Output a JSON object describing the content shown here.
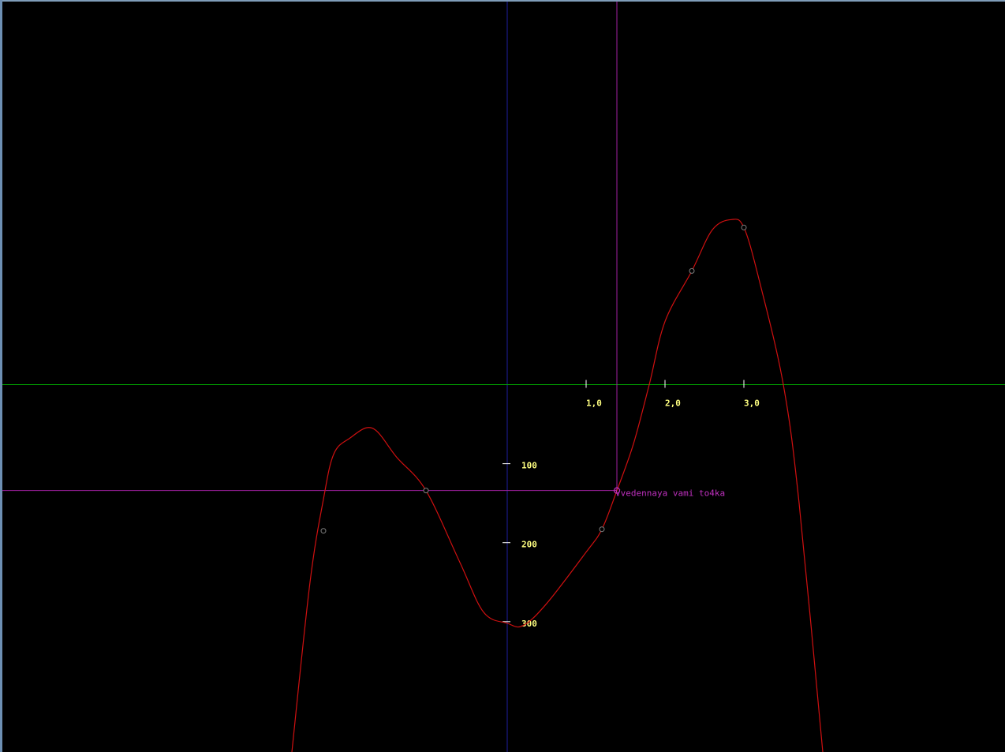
{
  "colors": {
    "background": "#000000",
    "x_axis": "#00b000",
    "y_axis": "#1e1ea0",
    "curve": "#d01010",
    "marker_line": "#a020a0",
    "tick_label": "#ffff80",
    "point_marker": "#808080",
    "annotation": "#c030c0"
  },
  "chart_data": {
    "type": "line",
    "title": "",
    "xlabel": "",
    "ylabel": "",
    "grid": false,
    "x_ticks": [
      {
        "value": 1.0,
        "label": "1,0"
      },
      {
        "value": 2.0,
        "label": "2,0"
      },
      {
        "value": 3.0,
        "label": "3,0"
      }
    ],
    "y_ticks": [
      {
        "value": -100,
        "label": "100"
      },
      {
        "value": -200,
        "label": "200"
      },
      {
        "value": -300,
        "label": "300"
      }
    ],
    "xlim": [
      -6.43,
      6.31
    ],
    "ylim": [
      -465,
      487
    ],
    "series": [
      {
        "points": [
          [
            -2.73,
            -465
          ],
          [
            -2.5,
            -250
          ],
          [
            -2.33,
            -145
          ],
          [
            -2.2,
            -88
          ],
          [
            -2.0,
            -68
          ],
          [
            -1.71,
            -55
          ],
          [
            -1.4,
            -92
          ],
          [
            -1.03,
            -134
          ],
          [
            -0.6,
            -225
          ],
          [
            -0.3,
            -288
          ],
          [
            0.0,
            -302
          ],
          [
            0.2,
            -305
          ],
          [
            0.5,
            -277
          ],
          [
            1.0,
            -212
          ],
          [
            1.2,
            -183
          ],
          [
            1.39,
            -134
          ],
          [
            1.6,
            -75
          ],
          [
            1.8,
            0
          ],
          [
            2.0,
            80
          ],
          [
            2.34,
            144
          ],
          [
            2.6,
            196
          ],
          [
            2.84,
            209
          ],
          [
            3.0,
            199
          ],
          [
            3.2,
            130
          ],
          [
            3.5,
            0
          ],
          [
            3.7,
            -150
          ],
          [
            4.0,
            -465
          ]
        ]
      }
    ],
    "sample_points": [
      [
        -2.33,
        -185
      ],
      [
        -1.03,
        -134
      ],
      [
        1.2,
        -183
      ],
      [
        2.34,
        144
      ],
      [
        3.0,
        199
      ]
    ],
    "entered_point": {
      "x": 1.39,
      "y": -134,
      "label": "Vvedennaya vami to4ka"
    }
  }
}
